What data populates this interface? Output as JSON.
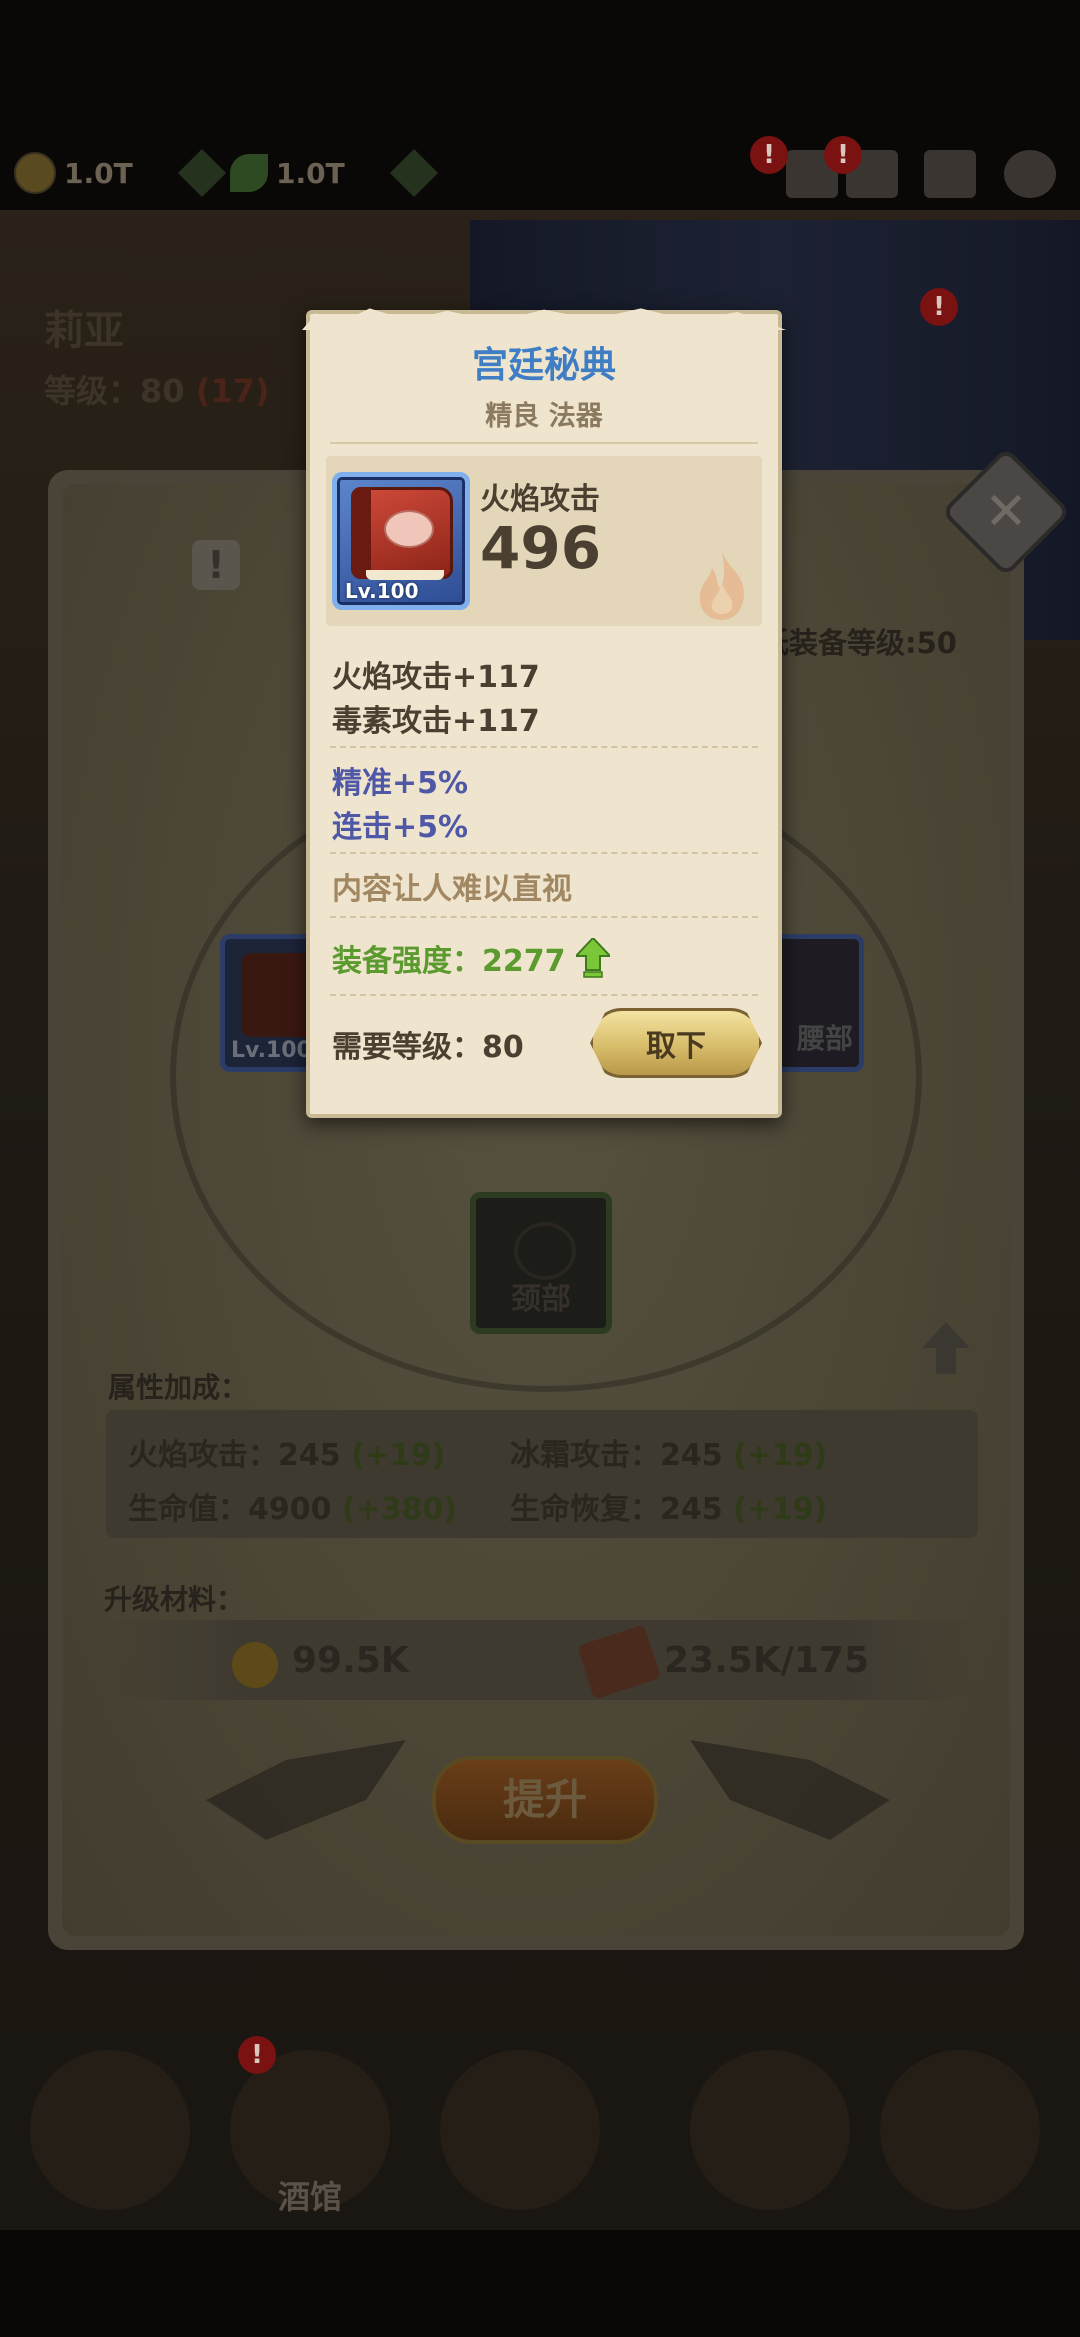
{
  "header": {
    "gold": "1.0T",
    "gems": "1.0T",
    "alert_mark": "!"
  },
  "hero": {
    "name": "莉亚",
    "level_label": "等级：",
    "level": "80",
    "level_bonus": "(17)"
  },
  "panel": {
    "warning_mark": "!",
    "close_glyph": "✕",
    "min_equip_level": "低装备等级:50",
    "slot_left_lv": "Lv.100",
    "slot_right_label": "腰部",
    "slot_head_label": "颈部",
    "attributes_title": "属性加成：",
    "attributes": [
      {
        "name": "火焰攻击：",
        "value": "245",
        "bonus": "(+19)"
      },
      {
        "name": "冰霜攻击：",
        "value": "245",
        "bonus": "(+19)"
      },
      {
        "name": "生命值：",
        "value": "4900",
        "bonus": "(+380)"
      },
      {
        "name": "生命恢复：",
        "value": "245",
        "bonus": "(+19)"
      }
    ],
    "materials_title": "升级材料：",
    "gold_cost": "99.5K",
    "scroll_cost": "23.5K/175",
    "upgrade_label": "提升"
  },
  "nav": {
    "tavern_label": "酒馆"
  },
  "item": {
    "name": "宫廷秘典",
    "quality_type": "精良 法器",
    "level_badge": "Lv.100",
    "main_stat_label": "火焰攻击",
    "main_stat_value": "496",
    "base_stats": [
      "火焰攻击+117",
      "毒素攻击+117"
    ],
    "extra_stats": [
      "精准+5%",
      "连击+5%"
    ],
    "flavor_text": "内容让人难以直视",
    "power_label": "装备强度：2277",
    "required_level": "需要等级：80",
    "unequip_label": "取下"
  },
  "colors": {
    "title_blue": "#3f7ec4",
    "extra_stat_purple": "#4e58a6",
    "power_green": "#5b9a2e",
    "flavor_brown": "#a28862"
  }
}
